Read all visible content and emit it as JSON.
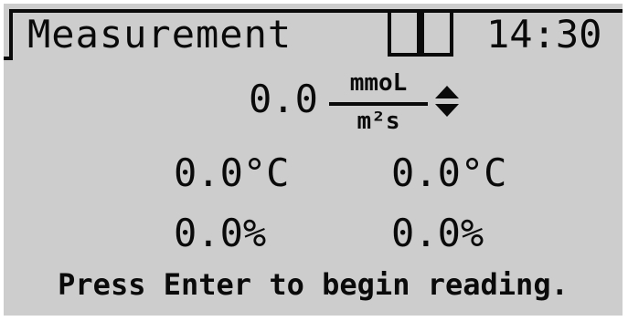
{
  "header": {
    "title": "Measurement",
    "time": "14:30"
  },
  "flux": {
    "value": "0.0",
    "unit_numerator": "mmoL",
    "unit_denominator": "m²s",
    "selector_icon": "up-down-arrow-icon"
  },
  "readouts": {
    "temperature_1": "0.0°C",
    "temperature_2": "0.0°C",
    "humidity_1": "0.0%",
    "humidity_2": "0.0%"
  },
  "status": {
    "prompt": "Press Enter to begin reading."
  },
  "colors": {
    "screen_background": "#cdcdcd",
    "foreground": "#0a0a0a",
    "frame": "#ffffff"
  }
}
